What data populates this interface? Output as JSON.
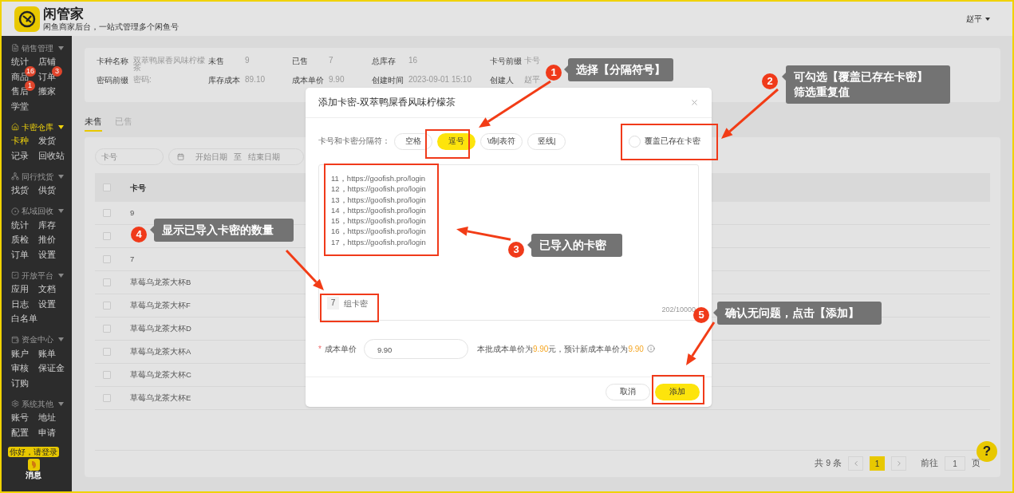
{
  "header": {
    "title": "闲管家",
    "subtitle": "闲鱼商家后台，一站式管理多个闲鱼号",
    "user": "赵平"
  },
  "sidebar": {
    "groups": [
      {
        "title": "销售管理",
        "selected": false,
        "items": [
          {
            "label": "统计",
            "selected": false
          },
          {
            "label": "店铺",
            "selected": false
          },
          {
            "label": "商品",
            "selected": false,
            "badge": "16"
          },
          {
            "label": "订单",
            "selected": false,
            "badge": "3"
          },
          {
            "label": "售后",
            "selected": false,
            "badge": "1"
          },
          {
            "label": "搬家",
            "selected": false
          },
          {
            "label": "学堂",
            "selected": false
          }
        ]
      },
      {
        "title": "卡密仓库",
        "selected": true,
        "items": [
          {
            "label": "卡种",
            "selected": true
          },
          {
            "label": "发货",
            "selected": false
          },
          {
            "label": "记录",
            "selected": false
          },
          {
            "label": "回收站",
            "selected": false
          }
        ]
      },
      {
        "title": "同行找货",
        "selected": false,
        "items": [
          {
            "label": "找货",
            "selected": false
          },
          {
            "label": "供货",
            "selected": false
          }
        ]
      },
      {
        "title": "私域回收",
        "selected": false,
        "items": [
          {
            "label": "统计",
            "selected": false
          },
          {
            "label": "库存",
            "selected": false
          },
          {
            "label": "质检",
            "selected": false
          },
          {
            "label": "推价",
            "selected": false
          },
          {
            "label": "订单",
            "selected": false
          },
          {
            "label": "设置",
            "selected": false
          }
        ]
      },
      {
        "title": "开放平台",
        "selected": false,
        "items": [
          {
            "label": "应用",
            "selected": false
          },
          {
            "label": "文档",
            "selected": false
          },
          {
            "label": "日志",
            "selected": false
          },
          {
            "label": "设置",
            "selected": false
          },
          {
            "label": "白名单",
            "selected": false
          }
        ]
      },
      {
        "title": "资金中心",
        "selected": false,
        "items": [
          {
            "label": "账户",
            "selected": false
          },
          {
            "label": "账单",
            "selected": false
          },
          {
            "label": "审核",
            "selected": false
          },
          {
            "label": "保证金",
            "selected": false
          },
          {
            "label": "订购",
            "selected": false
          }
        ]
      },
      {
        "title": "系统其他",
        "selected": false,
        "items": [
          {
            "label": "账号",
            "selected": false
          },
          {
            "label": "地址",
            "selected": false
          },
          {
            "label": "配置",
            "selected": false
          },
          {
            "label": "申请",
            "selected": false
          }
        ]
      }
    ],
    "login_tip": "你好，请登录",
    "message": "消息"
  },
  "info": {
    "rows": [
      [
        {
          "label": "卡种名称",
          "value": "双萃鸭屎香风味柠檬茶"
        },
        {
          "label": "未售",
          "value": "9"
        },
        {
          "label": "已售",
          "value": "7"
        },
        {
          "label": "总库存",
          "value": "16"
        },
        {
          "label": "卡号前缀",
          "value": "卡号"
        }
      ],
      [
        {
          "label": "密码前缀",
          "value": "密码:"
        },
        {
          "label": "库存成本",
          "value": "89.10"
        },
        {
          "label": "成本单价",
          "value": "9.90"
        },
        {
          "label": "创建时间",
          "value": "2023-09-01 15:10"
        },
        {
          "label": "创建人",
          "value": "赵平"
        }
      ]
    ]
  },
  "tabs": [
    {
      "label": "未售",
      "selected": true
    },
    {
      "label": "已售",
      "selected": false
    }
  ],
  "filters": {
    "card_no": {
      "placeholder": "卡号"
    },
    "date_range": {
      "start_placeholder": "开始日期",
      "separator": "至",
      "end_placeholder": "结束日期"
    }
  },
  "table": {
    "columns": [
      "卡号"
    ],
    "select_all": {
      "checked": false
    },
    "rows": [
      {
        "card_no": "9",
        "checked": false
      },
      {
        "checked": false
      },
      {
        "card_no": "7",
        "checked": false
      },
      {
        "card_no": "草莓乌龙茶大杯B",
        "checked": false
      },
      {
        "card_no": "草莓乌龙茶大杯F",
        "checked": false
      },
      {
        "card_no": "草莓乌龙茶大杯D",
        "checked": false
      },
      {
        "card_no": "草莓乌龙茶大杯A",
        "checked": false
      },
      {
        "card_no": "草莓乌龙茶大杯C",
        "checked": false
      },
      {
        "card_no": "草莓乌龙茶大杯E",
        "checked": false
      }
    ]
  },
  "pagination": {
    "total": "共 9 条",
    "pages": [
      {
        "label": "1",
        "selected": true
      }
    ],
    "goto_label": "前往",
    "goto_value": "1",
    "page_unit": "页"
  },
  "help": "?",
  "modal": {
    "title": "添加卡密-双萃鸭屎香风味柠檬茶",
    "separator_label": "卡号和卡密分隔符：",
    "separators": [
      {
        "label": "空格",
        "selected": false
      },
      {
        "label": "逗号",
        "selected": true
      },
      {
        "label": "\\t制表符",
        "selected": false
      },
      {
        "label": "竖线|",
        "selected": false
      }
    ],
    "overwrite": {
      "label": "覆盖已存在卡密",
      "checked": false
    },
    "lines": [
      "11，https://goofish.pro/login",
      "12，https://goofish.pro/login",
      "13，https://goofish.pro/login",
      "14，https://goofish.pro/login",
      "15，https://goofish.pro/login",
      "16，https://goofish.pro/login",
      "17，https://goofish.pro/login"
    ],
    "group_count": "7",
    "group_label": "组卡密",
    "char_count": "202/10000",
    "cost_required": "*",
    "cost_label": "成本单价",
    "cost_value": "9.90",
    "cost_note": [
      {
        "text": "本批成本单价为",
        "highlight": false
      },
      {
        "text": "9.90",
        "highlight": true
      },
      {
        "text": "元，预计新成本单价为",
        "highlight": false
      },
      {
        "text": "9.90",
        "highlight": true
      }
    ],
    "buttons": [
      {
        "label": "取消",
        "kind": "secondary"
      },
      {
        "label": "添加",
        "kind": "primary"
      }
    ]
  },
  "annotations": [
    {
      "number": "1",
      "lines": [
        "选择【分隔符号】"
      ]
    },
    {
      "number": "2",
      "lines": [
        "可勾选【覆盖已存在卡密】",
        "筛选重复值"
      ]
    },
    {
      "number": "3",
      "lines": [
        "已导入的卡密"
      ]
    },
    {
      "number": "4",
      "lines": [
        "显示已导入卡密的数量"
      ]
    },
    {
      "number": "5",
      "lines": [
        "确认无问题，点击【添加】"
      ]
    }
  ]
}
